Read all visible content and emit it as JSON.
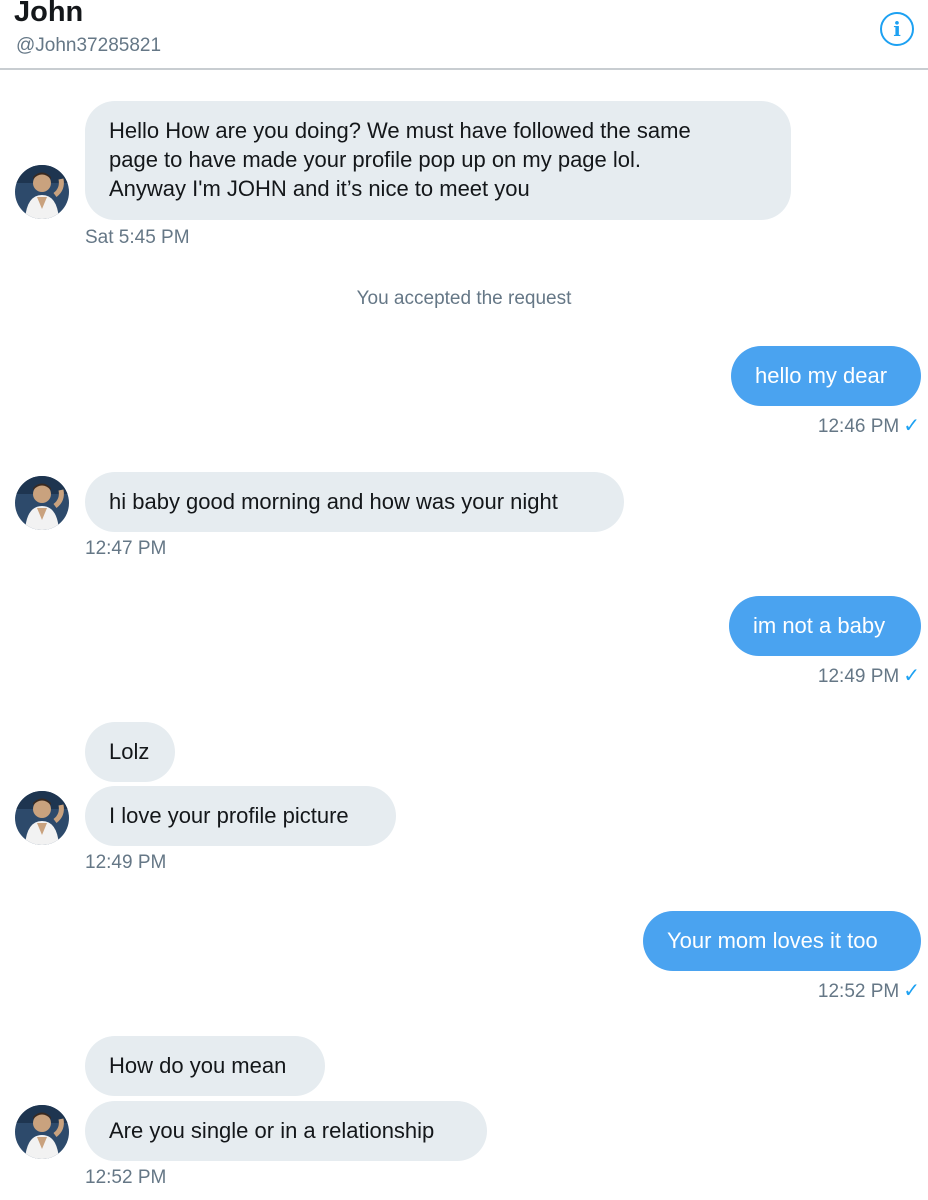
{
  "header": {
    "name": "John",
    "handle": "@John37285821",
    "info_icon": "info-icon"
  },
  "colors": {
    "accent": "#1da1f2",
    "outgoing_bubble": "#4aa3f0",
    "incoming_bubble": "#e6ecf0",
    "muted_text": "#657786"
  },
  "messages": {
    "m1": {
      "text": "Hello How are you doing? We must have followed the same\npage to have made your profile pop up on my page lol.\nAnyway I'm JOHN and it’s nice to meet you",
      "time": "Sat 5:45 PM"
    },
    "system_note": "You accepted the request",
    "m2": {
      "text": "hello my dear",
      "time": "12:46 PM",
      "check": "✓"
    },
    "m3": {
      "text": "hi baby good morning and how was your night",
      "time": "12:47 PM"
    },
    "m4": {
      "text": "im not a baby",
      "time": "12:49 PM",
      "check": "✓"
    },
    "m5": {
      "text": "Lolz"
    },
    "m6": {
      "text": "I love your profile picture",
      "time": "12:49 PM"
    },
    "m7": {
      "text": "Your mom loves it too",
      "time": "12:52 PM",
      "check": "✓"
    },
    "m8": {
      "text": "How do you mean"
    },
    "m9": {
      "text": "Are you single or in a relationship",
      "time": "12:52 PM"
    }
  }
}
